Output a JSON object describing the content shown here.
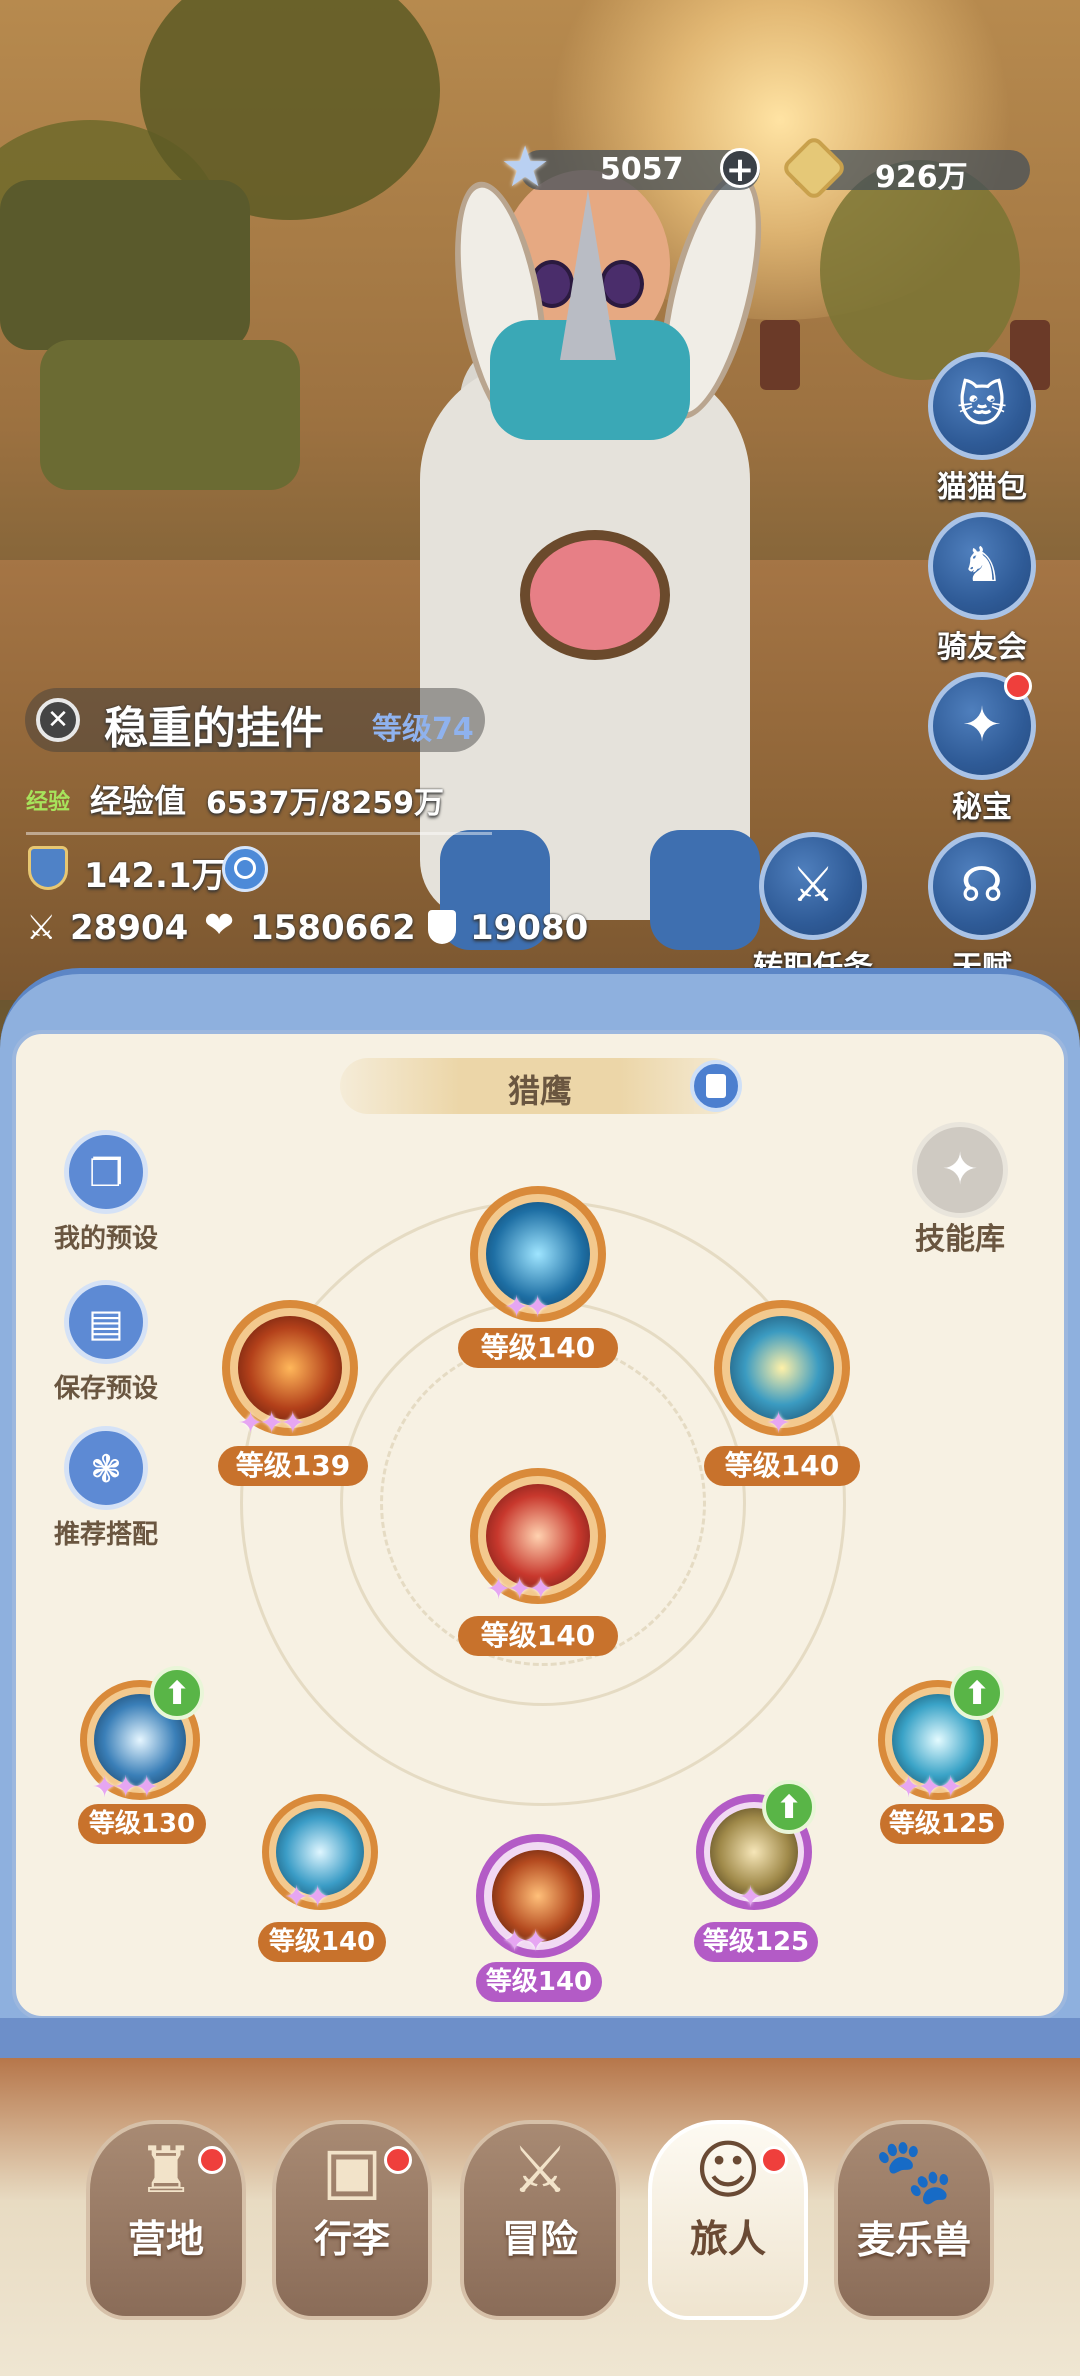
{
  "currency": {
    "stars": "5057",
    "coins": "926万"
  },
  "side_buttons": [
    {
      "label": "猫猫包",
      "icon": "cat-bag-icon",
      "badge": false
    },
    {
      "label": "骑友会",
      "icon": "horse-icon",
      "badge": false
    },
    {
      "label": "秘宝",
      "icon": "treasure-icon",
      "badge": true
    },
    {
      "label": "天赋",
      "icon": "brain-icon",
      "badge": false
    }
  ],
  "job_task": {
    "label": "转职任务",
    "icon": "job-change-icon"
  },
  "player": {
    "name": "稳重的挂件",
    "level_text": "等级74",
    "exp_tag": "经验",
    "exp_label": "经验值",
    "exp_value": "6537万/8259万",
    "power": "142.1万",
    "attack": "28904",
    "hp": "1580662",
    "defense": "19080"
  },
  "panel": {
    "class_name": "猎鹰",
    "skill_library": "技能库",
    "left_buttons": [
      {
        "label": "我的预设",
        "icon": "preset-icon"
      },
      {
        "label": "保存预设",
        "icon": "save-icon"
      },
      {
        "label": "推荐搭配",
        "icon": "recommend-icon"
      }
    ],
    "skills": [
      {
        "name": "skill-top",
        "level": "等级140",
        "stars": 2,
        "upgrade": false
      },
      {
        "name": "skill-upper-left",
        "level": "等级139",
        "stars": 3,
        "upgrade": false
      },
      {
        "name": "skill-upper-right",
        "level": "等级140",
        "stars": 1,
        "upgrade": false
      },
      {
        "name": "skill-center",
        "level": "等级140",
        "stars": 3,
        "upgrade": false
      },
      {
        "name": "skill-bottom-1",
        "level": "等级130",
        "stars": 3,
        "upgrade": true
      },
      {
        "name": "skill-bottom-2",
        "level": "等级140",
        "stars": 2,
        "upgrade": false
      },
      {
        "name": "skill-bottom-3",
        "level": "等级140",
        "stars": 2,
        "upgrade": false
      },
      {
        "name": "skill-bottom-4",
        "level": "等级125",
        "stars": 1,
        "upgrade": true
      },
      {
        "name": "skill-bottom-5",
        "level": "等级125",
        "stars": 3,
        "upgrade": true
      }
    ]
  },
  "nav": [
    {
      "label": "营地",
      "icon": "castle-icon",
      "badge": true,
      "active": false
    },
    {
      "label": "行李",
      "icon": "luggage-icon",
      "badge": true,
      "active": false
    },
    {
      "label": "冒险",
      "icon": "crossed-swords-icon",
      "badge": false,
      "active": false
    },
    {
      "label": "旅人",
      "icon": "traveler-icon",
      "badge": true,
      "active": true
    },
    {
      "label": "麦乐兽",
      "icon": "pet-icon",
      "badge": false,
      "active": false
    }
  ],
  "colors": {
    "accent_blue": "#5c86c6",
    "badge_red": "#ef3f3c",
    "level_orange": "#c8722c",
    "level_purple": "#b35bc6",
    "upgrade_green": "#59b547"
  }
}
